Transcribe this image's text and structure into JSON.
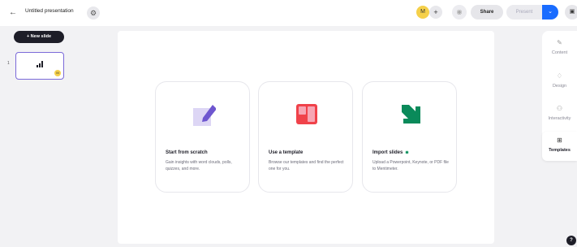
{
  "header": {
    "back_icon": "←",
    "title": "Untitled presentation",
    "settings_icon": "⚙",
    "avatar_initial": "M",
    "add_collaborator_icon": "+",
    "preview_icon": "◉",
    "share_label": "Share",
    "present_label": "Present",
    "present_dropdown_icon": "⌄",
    "menu_icon": "▣"
  },
  "sidebar": {
    "new_slide_label": "+ New slide",
    "slides": [
      {
        "number": "1",
        "badge": "M"
      }
    ]
  },
  "canvas": {
    "cards": [
      {
        "title": "Start from scratch",
        "description": "Gain insights with word clouds, polls, quizzes, and more.",
        "icon": "edit-icon"
      },
      {
        "title": "Use a template",
        "description": "Browse our templates and find the perfect one for you.",
        "icon": "template-icon"
      },
      {
        "title": "Import slides",
        "description": "Upload a Powerpoint, Keynote, or PDF file to Mentimeter.",
        "icon": "import-arrow-icon",
        "has_new_dot": true
      }
    ]
  },
  "right_panel": {
    "items": [
      {
        "label": "Content",
        "icon": "✎",
        "active": false
      },
      {
        "label": "Design",
        "icon": "♢",
        "active": false
      },
      {
        "label": "Interactivity",
        "icon": "⚇",
        "active": false
      },
      {
        "label": "Templates",
        "icon": "⊞",
        "active": true
      }
    ]
  },
  "help_label": "?",
  "colors": {
    "accent_blue": "#196cff",
    "avatar_yellow": "#f5d04a",
    "thumb_border": "#7b6ad9",
    "scratch_purple": "#6e56cf",
    "scratch_light": "#ddd6f5",
    "template_red": "#f0424a",
    "template_pink": "#f7a6b4",
    "import_green": "#0a8a5a"
  }
}
